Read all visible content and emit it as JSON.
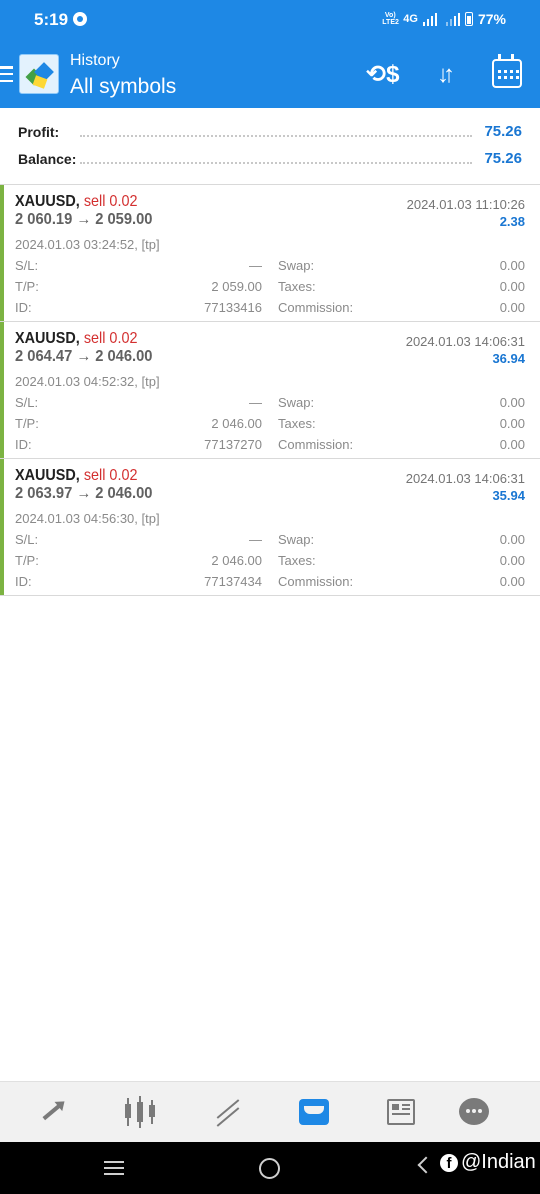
{
  "status_bar": {
    "time": "5:19",
    "network_label": "Vo) LTE2",
    "network_type": "4G",
    "battery": "77%"
  },
  "app_bar": {
    "subtitle": "History",
    "title": "All symbols",
    "icons": [
      "menu-icon",
      "app-logo",
      "currency-exchange-icon",
      "sort-icon",
      "calendar-icon"
    ]
  },
  "summary": {
    "profit_label": "Profit:",
    "profit_value": "75.26",
    "balance_label": "Balance:",
    "balance_value": "75.26"
  },
  "field_labels": {
    "sl": "S/L:",
    "tp": "T/P:",
    "id": "ID:",
    "swap": "Swap:",
    "taxes": "Taxes:",
    "commission": "Commission:"
  },
  "deals": [
    {
      "symbol": "XAUUSD,",
      "side": "sell 0.02",
      "prices": "2 060.19 → 2 059.00",
      "close_time": "2024.01.03 11:10:26",
      "profit": "2.38",
      "open_time": "2024.01.03 03:24:52, [tp]",
      "sl": "—",
      "tp": "2 059.00",
      "id": "77133416",
      "swap": "0.00",
      "taxes": "0.00",
      "commission": "0.00"
    },
    {
      "symbol": "XAUUSD,",
      "side": "sell 0.02",
      "prices": "2 064.47 → 2 046.00",
      "close_time": "2024.01.03 14:06:31",
      "profit": "36.94",
      "open_time": "2024.01.03 04:52:32, [tp]",
      "sl": "—",
      "tp": "2 046.00",
      "id": "77137270",
      "swap": "0.00",
      "taxes": "0.00",
      "commission": "0.00"
    },
    {
      "symbol": "XAUUSD,",
      "side": "sell 0.02",
      "prices": "2 063.97 → 2 046.00",
      "close_time": "2024.01.03 14:06:31",
      "profit": "35.94",
      "open_time": "2024.01.03 04:56:30, [tp]",
      "sl": "—",
      "tp": "2 046.00",
      "id": "77137434",
      "swap": "0.00",
      "taxes": "0.00",
      "commission": "0.00"
    }
  ],
  "bottom_nav": {
    "items": [
      "quotes-icon",
      "chart-icon",
      "trade-icon",
      "history-icon",
      "news-icon",
      "chat-icon"
    ],
    "active": "history-icon"
  },
  "watermark": "@Indian",
  "colors": {
    "accent_blue": "#1e88e5",
    "profit_blue": "#1976d2",
    "sell_red": "#d32f2f",
    "deal_marker_green": "#7cb342"
  }
}
